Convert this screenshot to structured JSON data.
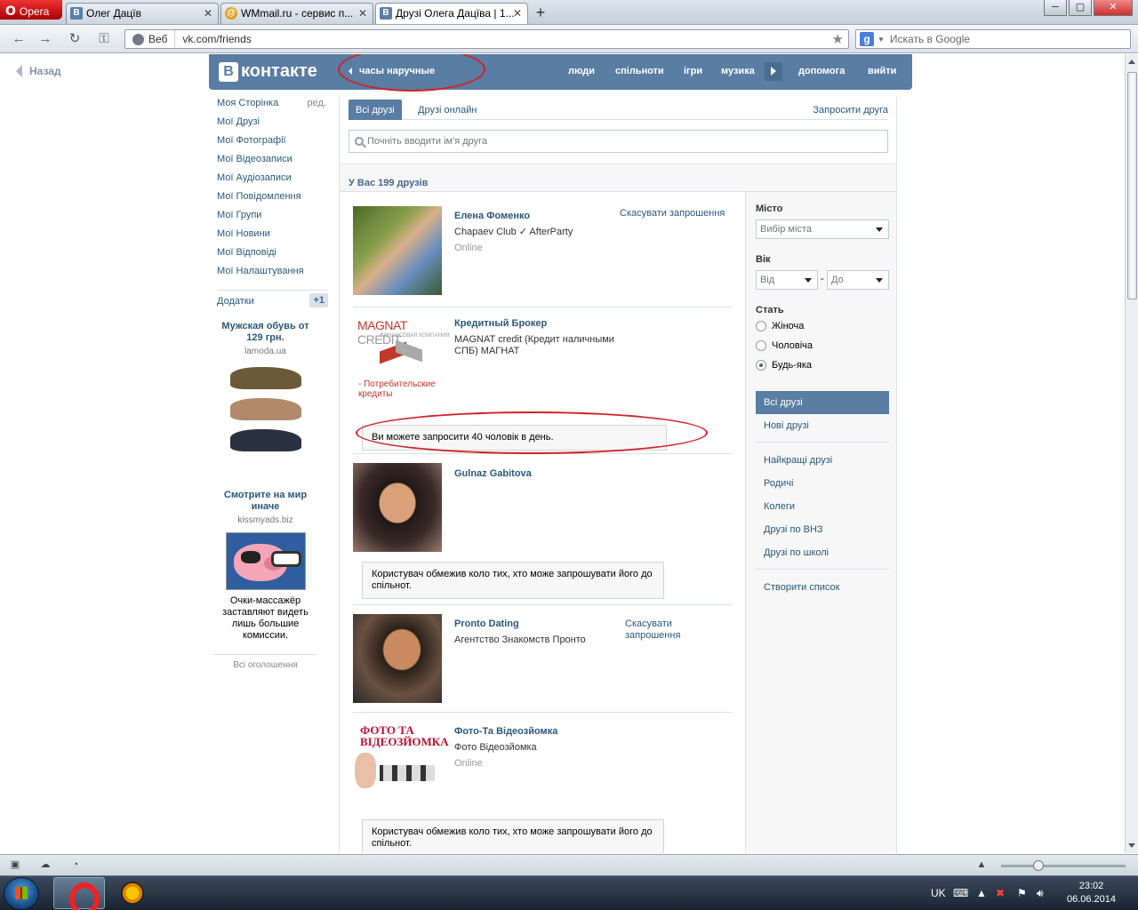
{
  "browser": {
    "menu_label": "Opera",
    "tabs": [
      {
        "label": "Олег Дацїв",
        "favicon": "В"
      },
      {
        "label": "WMmail.ru - сервис п...",
        "favicon": "@"
      },
      {
        "label": "Друзі Олега Дацїва | 1...",
        "favicon": "В"
      }
    ],
    "new_tab": "+",
    "address_prefix": "Веб",
    "url": "vk.com/friends",
    "search_placeholder": "Искать в Google",
    "window_buttons": [
      "─",
      "▢",
      "✕"
    ]
  },
  "vk": {
    "back_label": "Назад",
    "logo_letter": "В",
    "logo_text": "контакте",
    "status_text": "часы наручные",
    "top_menu": [
      "люди",
      "спільноти",
      "ігри",
      "музика",
      "допомога",
      "вийти"
    ],
    "left_menu": [
      "Моя Сторінка",
      "Мої Друзі",
      "Мої Фотографії",
      "Мої Відеозаписи",
      "Мої Аудіозаписи",
      "Мої Повідомлення",
      "Мої Групи",
      "Мої Новини",
      "Мої Відповіді",
      "Мої Налаштування"
    ],
    "edit_label": "ред.",
    "apps_label": "Додатки",
    "apps_badge": "+1",
    "ads": [
      {
        "title": "Мужская обувь от 129 грн.",
        "domain": "lamoda.ua"
      },
      {
        "title": "Смотрите на мир иначе",
        "domain": "kissmyads.biz",
        "text": "Очки-массажёр заставляют видеть лишь большие комиссии."
      }
    ],
    "all_ads": "Всі оголошення",
    "tabs": [
      "Всі друзі",
      "Друзі онлайн"
    ],
    "invite_friend": "Запросити друга",
    "search_placeholder": "Почніть вводити ім'я друга",
    "friends_count": "У Вас 199 друзів",
    "friends": [
      {
        "name": "Елена Фоменко",
        "sub": "Chapaev Club ✓ AfterParty",
        "online": "Online",
        "action": "Скасувати запрошення"
      },
      {
        "name": "Кредитный Брокер",
        "sub": "MAGNAT credit (Кредит наличными СПБ) МАГНАТ",
        "notice": "Ви можете запросити 40 чоловік в день."
      },
      {
        "name": "Gulnaz Gabitova",
        "notice": "Користувач обмежив коло тих, хто може запрошувати його до спільнот."
      },
      {
        "name": "Pronto Dating",
        "sub": "Агентство Знакомств Пронто",
        "action": "Скасувати запрошення"
      },
      {
        "name": "Фото-Та Відеозйомка",
        "sub": "Фото Відеозйомка",
        "online": "Online",
        "notice": "Користувач обмежив коло тих, хто може запрошувати його до спільнот."
      }
    ],
    "magnat_logo": {
      "l1": "MAGNAT",
      "l2": "CREDIT",
      "l3": "ФИНАНСОВАЯ КОМПАНИЯ",
      "l4": "- Потребительские кредиты"
    },
    "photo_logo": {
      "l1": "ФОТО ТА",
      "l2": "ВІДЕОЗЙОМКА"
    },
    "filters": {
      "city_label": "Місто",
      "city_select": "Вибір міста",
      "age_label": "Вік",
      "age_from": "Від",
      "age_dash": "-",
      "age_to": "До",
      "sex_label": "Стать",
      "sex_options": [
        "Жіноча",
        "Чоловіча",
        "Будь-яка"
      ],
      "sex_selected": "Будь-яка",
      "lists": [
        "Всі друзі",
        "Нові друзі",
        "Найкращі друзі",
        "Родичі",
        "Колеги",
        "Друзі по ВНЗ",
        "Друзі по школі",
        "Створити список"
      ]
    }
  },
  "taskbar": {
    "lang": "UK",
    "time": "23:02",
    "date": "06.06.2014"
  },
  "colors": {
    "vk_blue": "#597da3",
    "link": "#2b587a",
    "annotation_red": "#d0222a"
  }
}
